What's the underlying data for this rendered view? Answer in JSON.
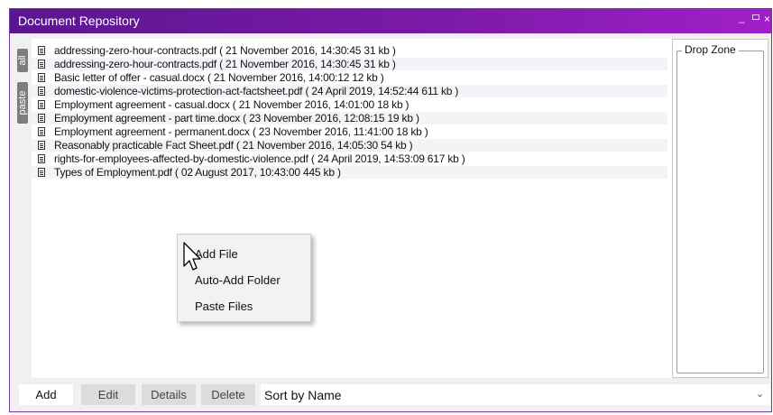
{
  "window": {
    "title": "Document Repository",
    "controls": {
      "minimize": "_",
      "maximize": "",
      "close": "×"
    }
  },
  "side_tabs": [
    "all",
    "paste"
  ],
  "files": [
    "addressing-zero-hour-contracts.pdf  ( 21 November 2016, 14:30:45  31 kb )",
    "addressing-zero-hour-contracts.pdf  ( 21 November 2016, 14:30:45  31 kb )",
    "Basic letter of offer - casual.docx  ( 21 November 2016, 14:00:12  12 kb )",
    "domestic-violence-victims-protection-act-factsheet.pdf  ( 24 April 2019, 14:52:44  611 kb )",
    "Employment agreement - casual.docx  ( 21 November 2016, 14:01:00  18 kb )",
    "Employment agreement - part time.docx  ( 23 November 2016, 12:08:15  19 kb )",
    "Employment agreement - permanent.docx  ( 23 November 2016, 11:41:00  18 kb )",
    "Reasonably practicable Fact Sheet.pdf  ( 21 November 2016, 14:05:30  54 kb )",
    "rights-for-employees-affected-by-domestic-violence.pdf  ( 24 April 2019, 14:53:09  617 kb )",
    "Types of Employment.pdf  ( 02 August 2017, 10:43:00  445 kb )"
  ],
  "drop_zone": {
    "label": "Drop Zone"
  },
  "context_menu": {
    "items": [
      "Add File",
      "Auto-Add Folder",
      "Paste Files"
    ]
  },
  "toolbar": {
    "add": "Add",
    "edit": "Edit",
    "details": "Details",
    "delete": "Delete",
    "sort": "Sort by Name"
  },
  "colors": {
    "titlebar_start": "#5a1690",
    "titlebar_end": "#a020c8",
    "row_alt": "#f2f4f8"
  }
}
